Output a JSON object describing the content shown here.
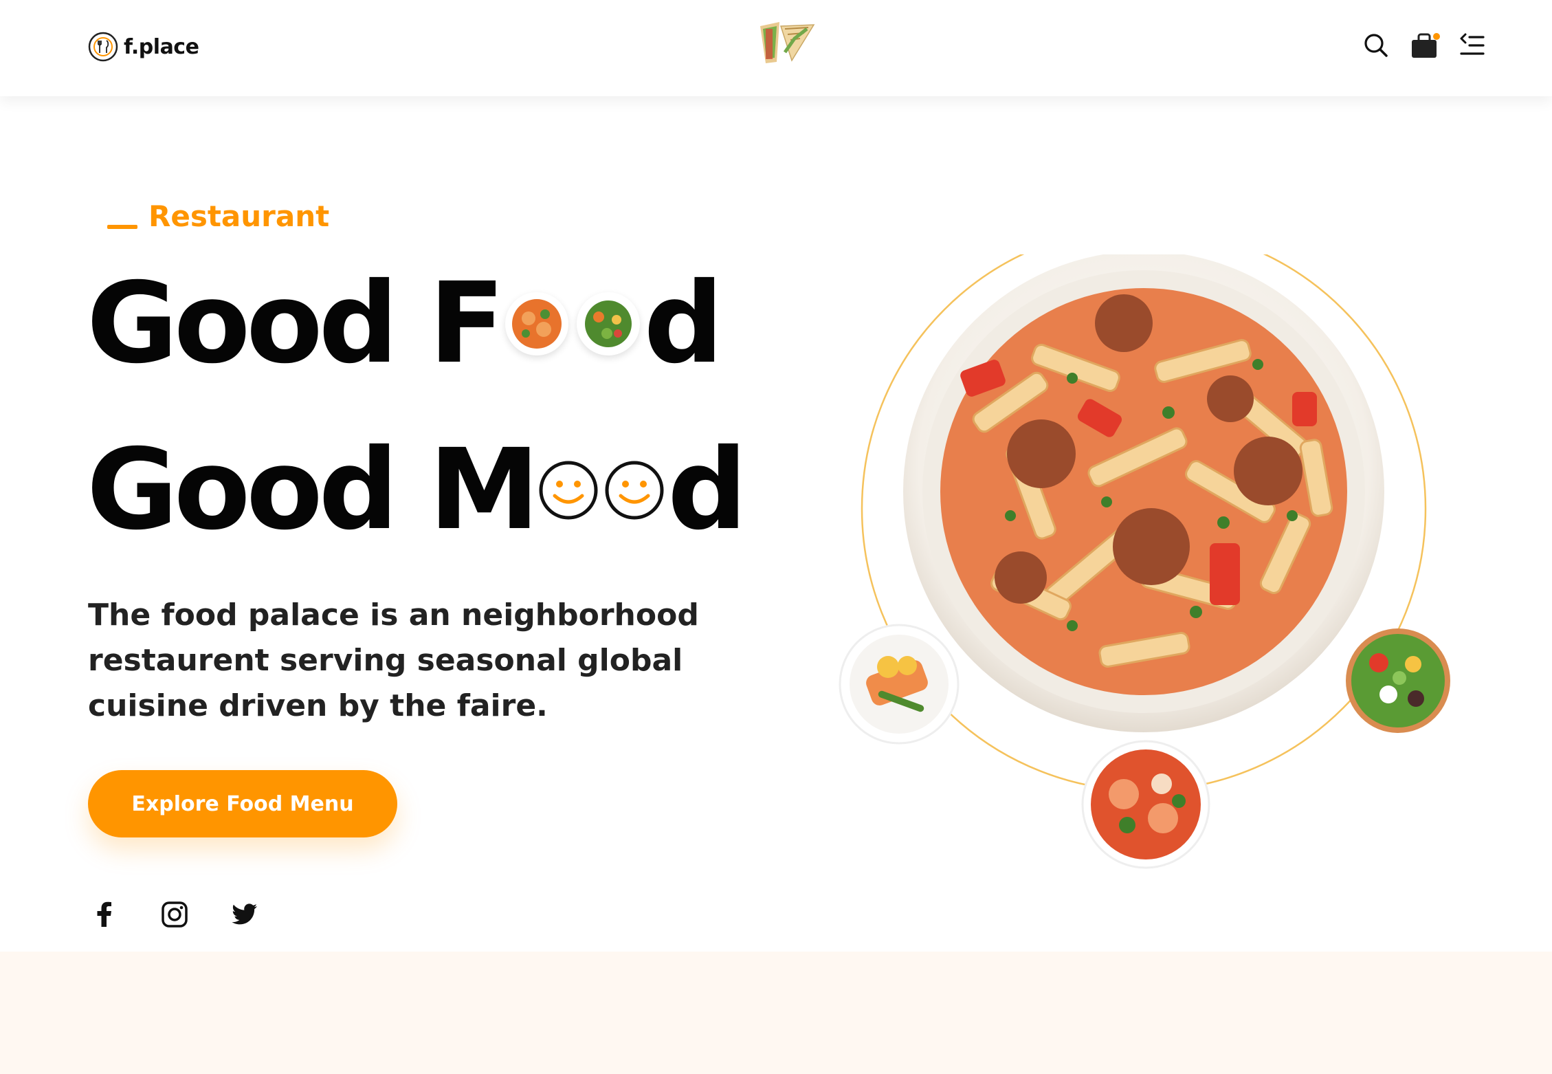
{
  "header": {
    "brand_name": "f.place",
    "icons": [
      "brand-icon",
      "sandwich-logo-icon",
      "search-icon",
      "cart-icon",
      "menu-icon"
    ]
  },
  "hero": {
    "eyebrow": "Restaurant",
    "line1_part1": "Good F",
    "line1_part2": "d",
    "line2_part1": "Good M",
    "line2_part2": "d",
    "description": "The food palace is an neighborhood restaurent serving seasonal global cuisine driven by the faire.",
    "cta_label": "Explore Food Menu"
  },
  "social": [
    "facebook-icon",
    "instagram-icon",
    "twitter-icon"
  ],
  "colors": {
    "accent": "#ff9500",
    "text": "#050505",
    "bottom_band": "#fff8f2"
  }
}
